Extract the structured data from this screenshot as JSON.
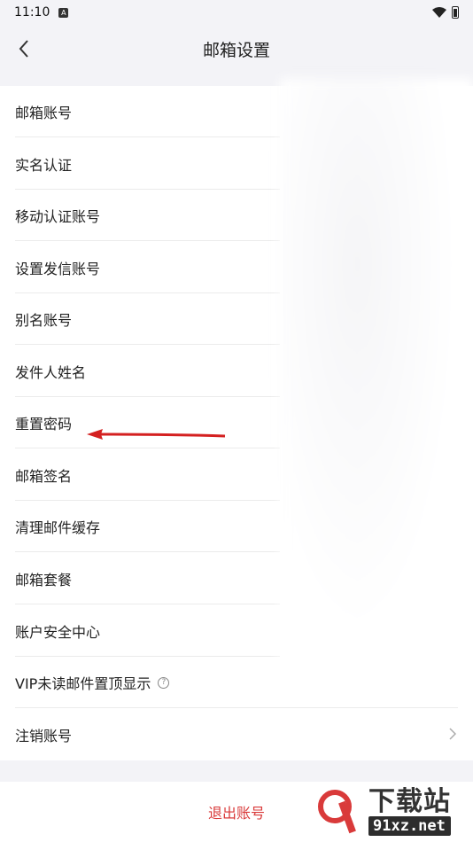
{
  "status_bar": {
    "time": "11:10",
    "a_label": "A"
  },
  "nav": {
    "title": "邮箱设置"
  },
  "settings": {
    "items": [
      {
        "label": "邮箱账号"
      },
      {
        "label": "实名认证"
      },
      {
        "label": "移动认证账号"
      },
      {
        "label": "设置发信账号"
      },
      {
        "label": "别名账号"
      },
      {
        "label": "发件人姓名"
      },
      {
        "label": "重置密码"
      },
      {
        "label": "邮箱签名"
      },
      {
        "label": "清理邮件缓存"
      },
      {
        "label": "邮箱套餐"
      },
      {
        "label": "账户安全中心"
      },
      {
        "label": "VIP未读邮件置顶显示"
      },
      {
        "label": "注销账号"
      }
    ]
  },
  "help_icon_glyph": "?",
  "logout": {
    "label": "退出账号"
  },
  "watermark": {
    "title": "下载站",
    "url": "91xz.net"
  },
  "colors": {
    "accent_red": "#d93a3a",
    "arrow_red": "#d42020"
  },
  "icons": {
    "back": "chevron-left-icon",
    "row_arrow": "chevron-right-icon",
    "help": "help-circle-icon"
  }
}
